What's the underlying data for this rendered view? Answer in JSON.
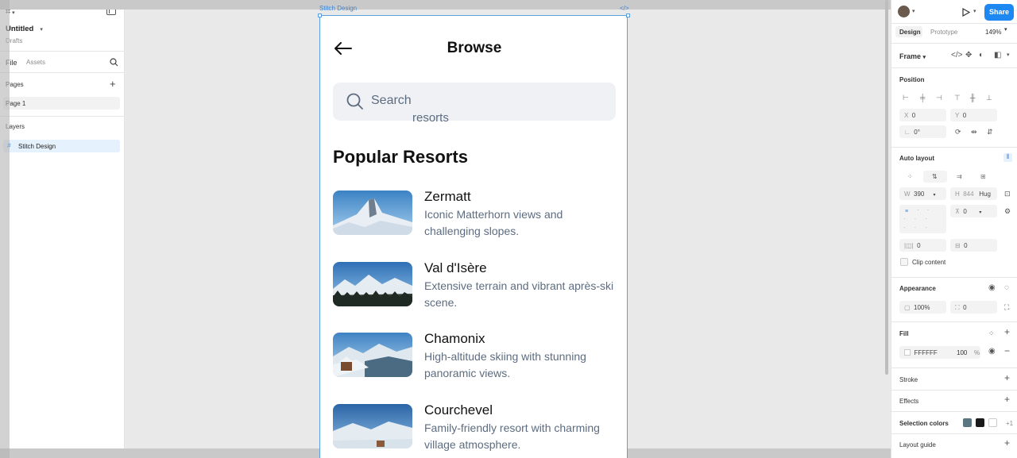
{
  "left_panel": {
    "file_name": "Untitled",
    "location": "Drafts",
    "tabs": [
      "File",
      "Assets"
    ],
    "pages_label": "Pages",
    "pages": [
      "Page 1"
    ],
    "layers_label": "Layers",
    "layers": [
      "Stitch Design"
    ]
  },
  "canvas": {
    "frame_name": "Stitch Design",
    "frame_code_icon": "</>"
  },
  "app": {
    "title": "Browse",
    "search_placeholder": "Search",
    "search_overflow": "resorts",
    "section_title": "Popular Resorts",
    "resorts": [
      {
        "name": "Zermatt",
        "description": "Iconic Matterhorn views and challenging slopes."
      },
      {
        "name": "Val d'Isère",
        "description": "Extensive terrain and vibrant après-ski scene."
      },
      {
        "name": "Chamonix",
        "description": "High-altitude skiing with stunning panoramic views."
      },
      {
        "name": "Courchevel",
        "description": "Family-friendly resort with charming village atmosphere."
      }
    ]
  },
  "right_panel": {
    "share_label": "Share",
    "tabs": [
      "Design",
      "Prototype"
    ],
    "zoom": "149%",
    "frame_label": "Frame",
    "position_label": "Position",
    "x_label": "X",
    "x_value": "0",
    "y_label": "Y",
    "y_value": "0",
    "rotation_value": "0°",
    "auto_layout_label": "Auto layout",
    "w_label": "W",
    "w_value": "390",
    "h_label": "H",
    "h_value": "844",
    "h_mode": "Hug",
    "gap_value": "0",
    "padding_h_value": "0",
    "padding_v_value": "0",
    "clip_content_label": "Clip content",
    "appearance_label": "Appearance",
    "opacity_value": "100%",
    "radius_value": "0",
    "fill_label": "Fill",
    "fill_hex": "FFFFFF",
    "fill_opacity": "100",
    "fill_percent": "%",
    "stroke_label": "Stroke",
    "effects_label": "Effects",
    "selection_colors_label": "Selection colors",
    "selection_more": "+1",
    "layout_guide_label": "Layout guide",
    "selection_colors": [
      "#5a7680",
      "#1a1a1a",
      "#ffffff"
    ]
  },
  "colors": {
    "accent": "#1e88f2",
    "frame_outline": "#5aa0e0",
    "search_bg": "#eff1f5",
    "muted_text": "#5d6c80"
  }
}
